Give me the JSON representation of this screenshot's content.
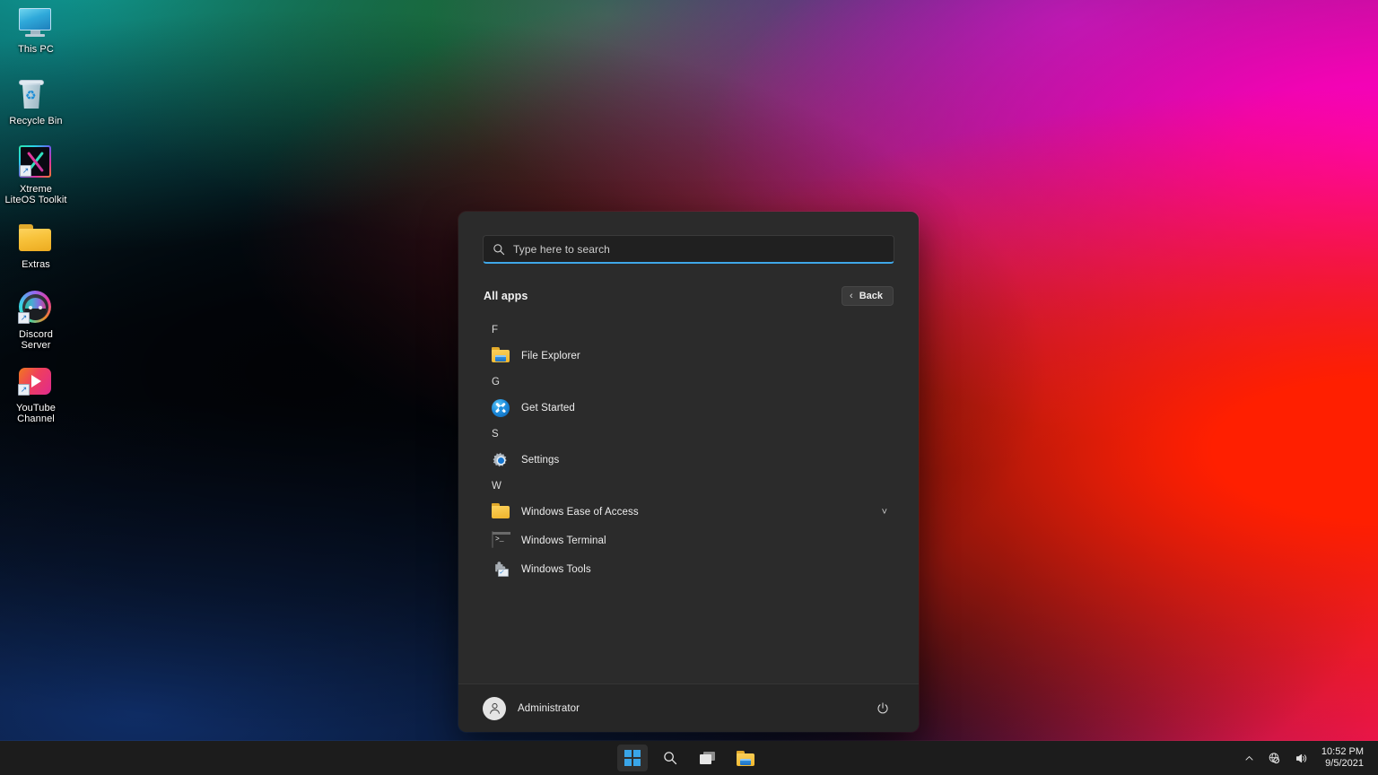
{
  "desktop": {
    "icons": [
      {
        "label": "This PC",
        "icon": "this-pc-monitor-icon",
        "shortcut": false
      },
      {
        "label": "Recycle Bin",
        "icon": "recycle-bin-icon",
        "shortcut": false
      },
      {
        "label": "Xtreme\nLiteOS Toolkit",
        "icon": "xtreme-liteos-toolkit-icon",
        "shortcut": true
      },
      {
        "label": "Extras",
        "icon": "folder-icon",
        "shortcut": false
      },
      {
        "label": "Discord\nServer",
        "icon": "discord-icon",
        "shortcut": true
      },
      {
        "label": "YouTube\nChannel",
        "icon": "youtube-icon",
        "shortcut": true
      }
    ]
  },
  "start_menu": {
    "search": {
      "placeholder": "Type here to search",
      "value": "",
      "icon": "search-icon",
      "accent_color": "#3fa7e8"
    },
    "header": {
      "title": "All apps",
      "back_label": "Back",
      "back_icon": "chevron-left-icon"
    },
    "app_list": [
      {
        "type": "group",
        "letter": "F"
      },
      {
        "type": "app",
        "label": "File Explorer",
        "icon": "file-explorer-icon",
        "expandable": false
      },
      {
        "type": "group",
        "letter": "G"
      },
      {
        "type": "app",
        "label": "Get Started",
        "icon": "get-started-icon",
        "expandable": false
      },
      {
        "type": "group",
        "letter": "S"
      },
      {
        "type": "app",
        "label": "Settings",
        "icon": "settings-gear-icon",
        "expandable": false
      },
      {
        "type": "group",
        "letter": "W"
      },
      {
        "type": "app",
        "label": "Windows Ease of Access",
        "icon": "folder-icon",
        "expandable": true,
        "expand_icon": "chevron-down-icon"
      },
      {
        "type": "app",
        "label": "Windows Terminal",
        "icon": "terminal-icon",
        "expandable": false
      },
      {
        "type": "app",
        "label": "Windows Tools",
        "icon": "windows-tools-icon",
        "expandable": false
      }
    ],
    "footer": {
      "user_name": "Administrator",
      "avatar_icon": "user-avatar-icon",
      "power_icon": "power-icon"
    }
  },
  "taskbar": {
    "buttons": [
      {
        "name": "start-button",
        "icon": "windows-logo-icon",
        "active": true
      },
      {
        "name": "search-button",
        "icon": "search-icon",
        "active": false
      },
      {
        "name": "task-view-button",
        "icon": "task-view-icon",
        "active": false
      },
      {
        "name": "file-explorer-button",
        "icon": "file-explorer-icon",
        "active": false
      }
    ],
    "tray": {
      "chevron_icon": "chevron-up-icon",
      "network_icon": "network-disconnected-icon",
      "volume_icon": "volume-icon",
      "time": "10:52 PM",
      "date": "9/5/2021"
    }
  }
}
